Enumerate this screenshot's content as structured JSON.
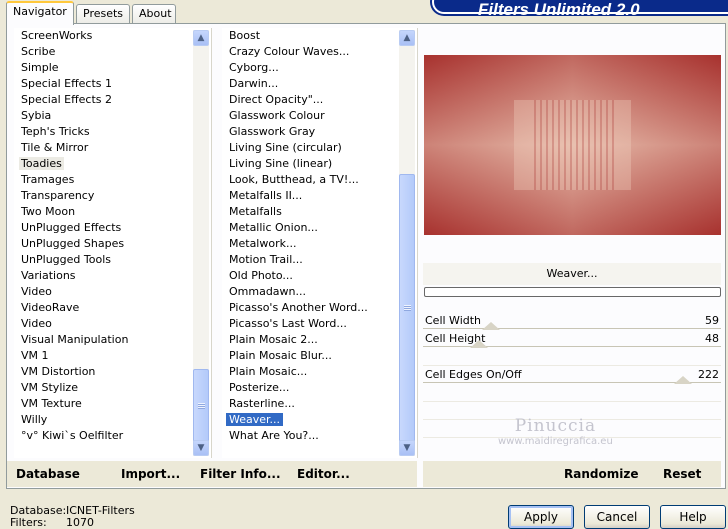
{
  "tabs": [
    {
      "label": "Navigator",
      "active": true
    },
    {
      "label": "Presets",
      "active": false
    },
    {
      "label": "About",
      "active": false
    }
  ],
  "header": {
    "title": "Filters Unlimited 2.0"
  },
  "categories": {
    "items": [
      "ScreenWorks",
      "Scribe",
      "Simple",
      "Special Effects 1",
      "Special Effects 2",
      "Sybia",
      "Teph's Tricks",
      "Tile & Mirror",
      "Toadies",
      "Tramages",
      "Transparency",
      "Two Moon",
      "UnPlugged Effects",
      "UnPlugged Shapes",
      "UnPlugged Tools",
      "Variations",
      "Video",
      "VideoRave",
      "Video",
      "Visual Manipulation",
      "VM 1",
      "VM Distortion",
      "VM Stylize",
      "VM Texture",
      "Willy",
      "°v° Kiwi`s Oelfilter"
    ],
    "selected": "Toadies"
  },
  "filters": {
    "items": [
      "Boost",
      "Crazy Colour Waves...",
      "Cyborg...",
      "Darwin...",
      "Direct Opacity\"...",
      "Glasswork Colour",
      "Glasswork Gray",
      "Living Sine (circular)",
      "Living Sine (linear)",
      "Look, Butthead, a TV!...",
      "Metalfalls II...",
      "Metalfalls",
      "Metallic Onion...",
      "Metalwork...",
      "Motion Trail...",
      "Old Photo...",
      "Ommadawn...",
      "Picasso's Another Word...",
      "Picasso's Last Word...",
      "Plain Mosaic 2...",
      "Plain Mosaic Blur...",
      "Plain Mosaic...",
      "Posterize...",
      "Rasterline...",
      "Weaver...",
      "What Are You?..."
    ],
    "selected": "Weaver..."
  },
  "scroll_icons": {
    "up": "scroll-up-arrow",
    "down": "scroll-down-arrow"
  },
  "preview": {
    "current_filter": "Weaver...",
    "colors": {
      "dark": "#9e1f1f",
      "mid": "#c46a5d",
      "light": "#f0d2c0"
    }
  },
  "params": [
    {
      "label": "Cell Width",
      "value": "59"
    },
    {
      "label": "Cell Height",
      "value": "48"
    },
    {
      "label": "Cell Edges On/Off",
      "value": "222"
    }
  ],
  "watermark": {
    "name": "Pinuccia",
    "site": "www.maidiregrafica.eu"
  },
  "toolbar": {
    "database": "Database",
    "import": "Import...",
    "filter_info": "Filter Info...",
    "editor": "Editor...",
    "randomize": "Randomize",
    "reset": "Reset"
  },
  "footer": {
    "database_label": "Database:",
    "database_value": "ICNET-Filters",
    "filters_label": "Filters:",
    "filters_value": "1070",
    "apply": "Apply",
    "cancel": "Cancel",
    "help": "Help"
  },
  "colors": {
    "accent": "#316ac5",
    "banner": "#0a2a8a",
    "tab_highlight": "#ffc83c"
  }
}
